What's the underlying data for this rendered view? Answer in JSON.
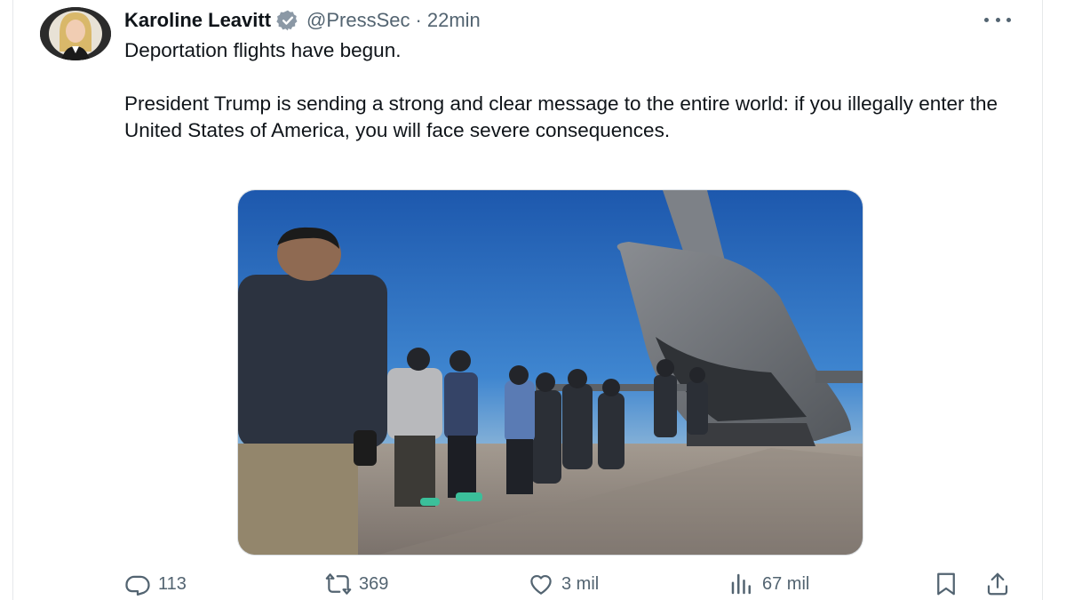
{
  "author": {
    "display_name": "Karoline Leavitt",
    "handle": "@PressSec",
    "separator": "·",
    "time": "22min",
    "verified_badge_color": "#8b98a5"
  },
  "tweet": {
    "lines": [
      "Deportation flights have begun.",
      "President Trump is sending a strong and clear message to the entire world: if you illegally enter the United States of America, you will face severe consequences."
    ]
  },
  "media": {
    "sky_color": "#1f5fb8",
    "tarmac_color": "#8a8079",
    "aircraft_color": "#6f7378"
  },
  "actions": {
    "reply": {
      "icon": "reply-icon",
      "count": "113"
    },
    "retweet": {
      "icon": "retweet-icon",
      "count": "369"
    },
    "like": {
      "icon": "heart-icon",
      "count": "3 mil"
    },
    "views": {
      "icon": "views-icon",
      "count": "67 mil"
    },
    "bookmark": {
      "icon": "bookmark-icon"
    },
    "share": {
      "icon": "share-icon"
    }
  },
  "colors": {
    "text_primary": "#0f1419",
    "text_secondary": "#536471"
  }
}
